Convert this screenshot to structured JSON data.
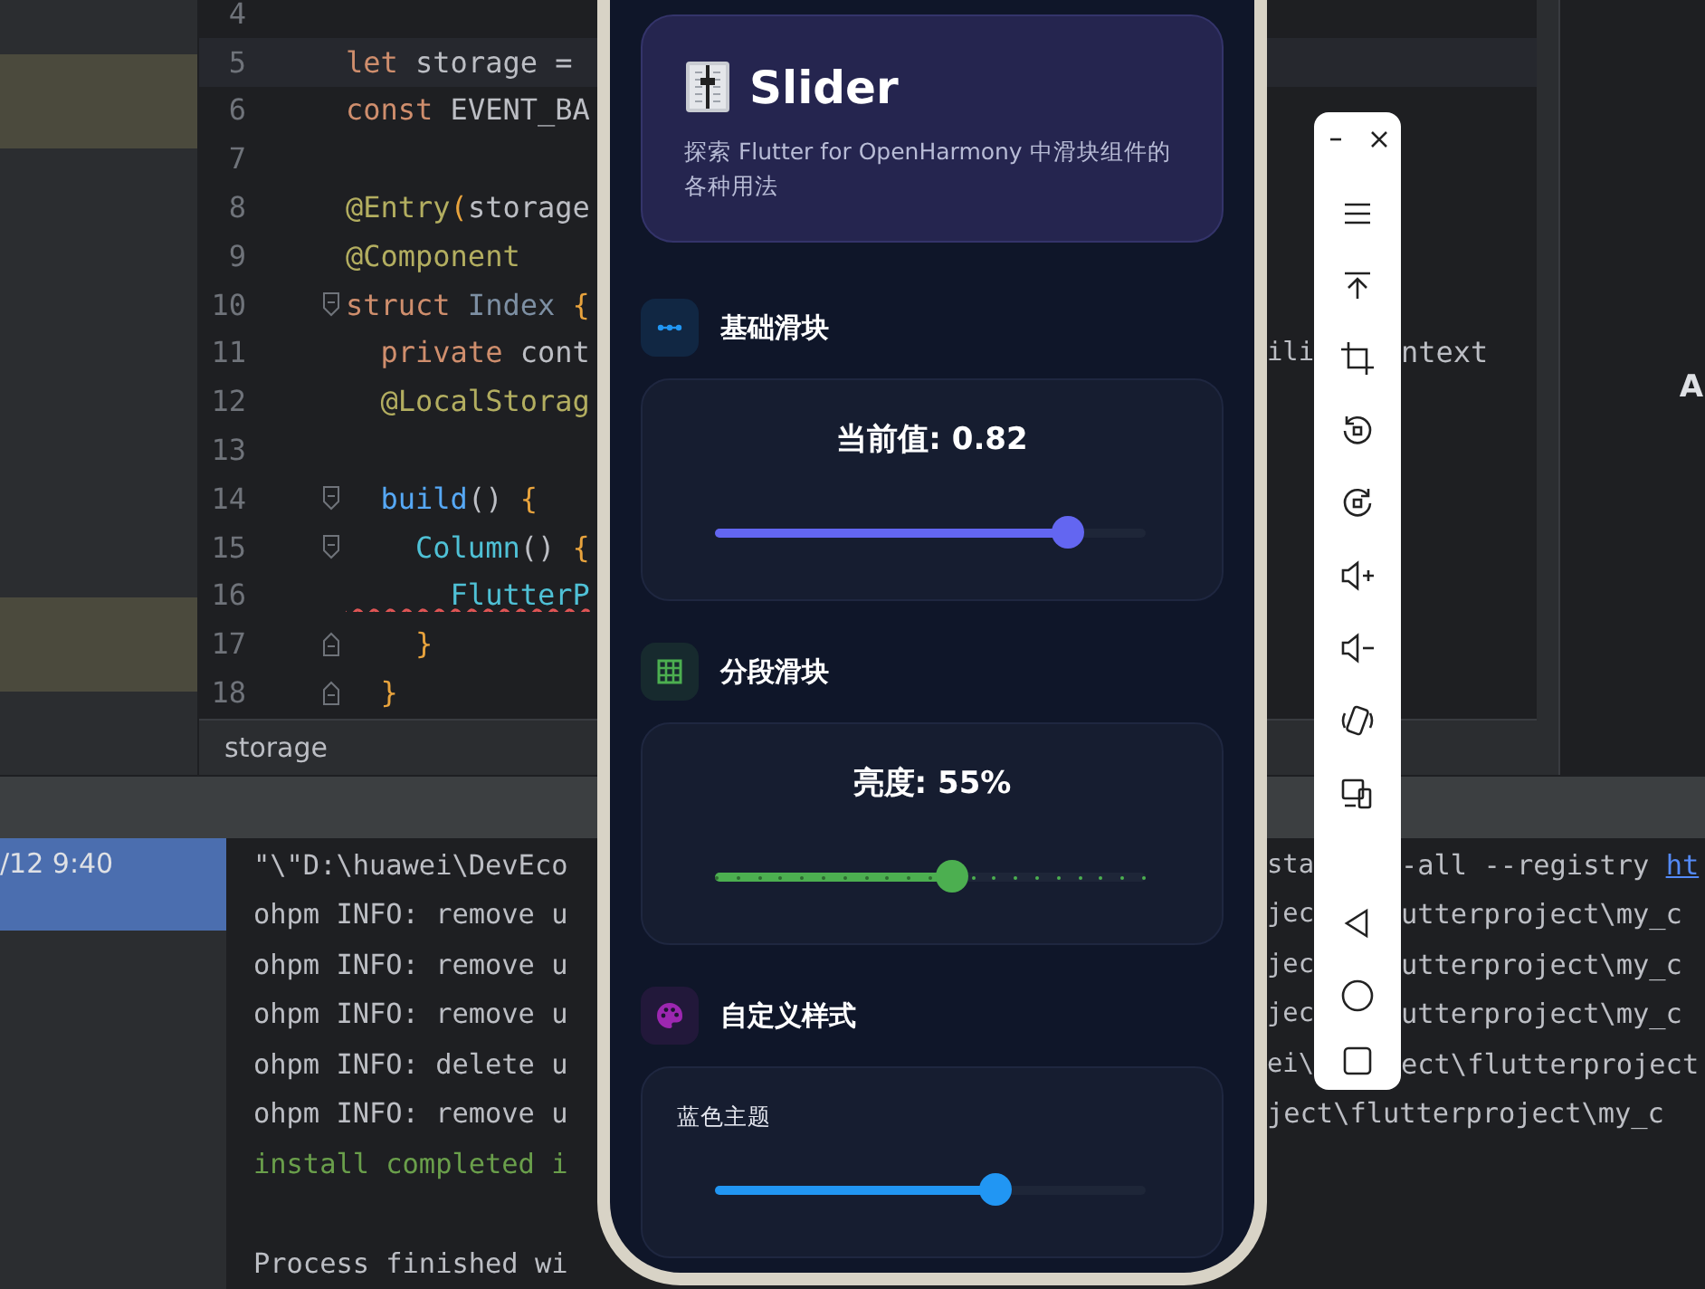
{
  "project_panel": {
    "highlights": [
      {
        "kind": "band"
      },
      {
        "kind": "band"
      }
    ]
  },
  "editor": {
    "lines": [
      {
        "number": "4",
        "current": false,
        "fold_start": false,
        "fold_end": false
      },
      {
        "number": "5",
        "current": true,
        "fold_start": false,
        "fold_end": false,
        "tokens": [
          {
            "kind": "keyword",
            "text": "let"
          },
          {
            "kind": "plain",
            "text": " storage ="
          }
        ]
      },
      {
        "number": "6",
        "current": false,
        "fold_start": false,
        "fold_end": false,
        "tokens": [
          {
            "kind": "keyword",
            "text": "const"
          },
          {
            "kind": "plain",
            "text": " EVENT_BA"
          }
        ]
      },
      {
        "number": "7",
        "current": false,
        "fold_start": false,
        "fold_end": false
      },
      {
        "number": "8",
        "current": false,
        "fold_start": false,
        "fold_end": false,
        "tokens": [
          {
            "kind": "annotation",
            "text": "@Entry"
          },
          {
            "kind": "brace",
            "text": "("
          },
          {
            "kind": "plain",
            "text": "storage"
          }
        ]
      },
      {
        "number": "9",
        "current": false,
        "fold_start": false,
        "fold_end": false,
        "tokens": [
          {
            "kind": "annotation",
            "text": "@Component"
          }
        ]
      },
      {
        "number": "10",
        "current": false,
        "fold_start": true,
        "fold_end": false,
        "tokens": [
          {
            "kind": "keyword",
            "text": "struct"
          },
          {
            "kind": "type",
            "text": " Index"
          },
          {
            "kind": "brace",
            "text": " {"
          }
        ]
      },
      {
        "number": "11",
        "current": false,
        "fold_start": false,
        "fold_end": false,
        "tokens": [
          {
            "kind": "keyword",
            "text": "  private"
          },
          {
            "kind": "plain",
            "text": " cont"
          }
        ],
        "after_phone": "ili",
        "after_toolbar": "ntext"
      },
      {
        "number": "12",
        "current": false,
        "fold_start": false,
        "fold_end": false,
        "tokens": [
          {
            "kind": "annotation",
            "text": "  @LocalStorag"
          }
        ]
      },
      {
        "number": "13",
        "current": false,
        "fold_start": false,
        "fold_end": false
      },
      {
        "number": "14",
        "current": false,
        "fold_start": true,
        "fold_end": false,
        "tokens": [
          {
            "kind": "function",
            "text": "  build"
          },
          {
            "kind": "plain",
            "text": "()"
          },
          {
            "kind": "brace",
            "text": " {"
          }
        ]
      },
      {
        "number": "15",
        "current": false,
        "fold_start": true,
        "fold_end": false,
        "tokens": [
          {
            "kind": "call",
            "text": "    Column"
          },
          {
            "kind": "plain",
            "text": "()"
          },
          {
            "kind": "brace",
            "text": " {"
          }
        ]
      },
      {
        "number": "16",
        "current": false,
        "fold_start": false,
        "fold_end": false,
        "tokens": [
          {
            "kind": "error",
            "text": "      FlutterP"
          }
        ]
      },
      {
        "number": "17",
        "current": false,
        "fold_start": false,
        "fold_end": true,
        "tokens": [
          {
            "kind": "brace",
            "text": "    }"
          }
        ]
      },
      {
        "number": "18",
        "current": false,
        "fold_start": false,
        "fold_end": true,
        "tokens": [
          {
            "kind": "brace",
            "text": "  }"
          }
        ]
      }
    ],
    "breadcrumb": "storage"
  },
  "side_panel": {
    "text": "A"
  },
  "run_panel": {
    "items": [
      {
        "label": "/12 9:40",
        "selected": true
      }
    ]
  },
  "console": {
    "lines": [
      {
        "kind": "plain",
        "left": "\"\\\"D:\\huawei\\DevEco",
        "after_phone": "sta",
        "after_toolbar": "-all --registry ",
        "link": "ht"
      },
      {
        "kind": "plain",
        "left": "ohpm INFO: remove u",
        "after_phone": "jec",
        "after_toolbar": "utterproject\\my_c"
      },
      {
        "kind": "plain",
        "left": "ohpm INFO: remove u",
        "after_phone": "jec",
        "after_toolbar": "utterproject\\my_c"
      },
      {
        "kind": "plain",
        "left": "ohpm INFO: remove u",
        "after_phone": "jec",
        "after_toolbar": "utterproject\\my_c"
      },
      {
        "kind": "plain",
        "left": "ohpm INFO: delete u",
        "after_phone": "ei\\",
        "after_toolbar": "ect\\flutterproject"
      },
      {
        "kind": "plain",
        "left": "ohpm INFO: remove u",
        "after_phone": "ject\\flutterproject\\my_c"
      },
      {
        "kind": "success",
        "left": "install completed i"
      },
      {
        "kind": "blank"
      },
      {
        "kind": "plain",
        "left": "Process finished wi"
      }
    ]
  },
  "phone": {
    "header": {
      "title": "Slider",
      "subtitle": "探索 Flutter for OpenHarmony 中滑块组件的各种用法"
    },
    "sections": [
      {
        "title": "基础滑块",
        "kind": "dots",
        "color": "#2196f3",
        "sliders": [
          {
            "label": "当前值: 0.82",
            "kind": "headline",
            "level": 0.82,
            "color": "#6366f1",
            "discrete": false
          }
        ]
      },
      {
        "title": "分段滑块",
        "kind": "grid",
        "color": "#4caf50",
        "sliders": [
          {
            "label": "亮度: 55%",
            "kind": "headline",
            "level": 0.55,
            "color": "#4caf50",
            "discrete": true
          }
        ]
      },
      {
        "title": "自定义样式",
        "kind": "palette",
        "color": "#9c27b0",
        "sliders": [
          {
            "label": "蓝色主题",
            "kind": "caption",
            "level": 0.65,
            "color": "#2196f3",
            "discrete": false
          }
        ]
      }
    ]
  }
}
